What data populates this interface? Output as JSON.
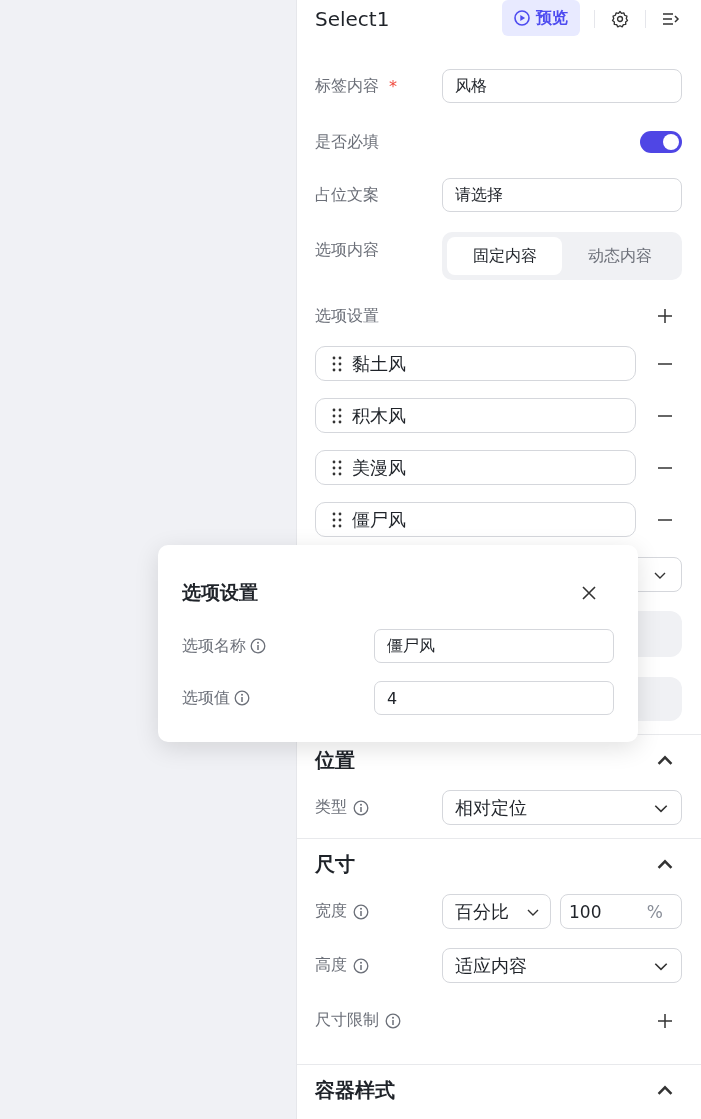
{
  "header": {
    "title": "Select1",
    "preview": "预览"
  },
  "fields": [
    {
      "kind": "input",
      "label": "标签内容",
      "required_mark": "*",
      "value": "风格"
    },
    {
      "kind": "switch",
      "label": "是否必填",
      "on": true
    },
    {
      "kind": "input",
      "label": "占位文案",
      "value": "请选择"
    },
    {
      "kind": "segmented",
      "label": "选项内容",
      "options": [
        {
          "label": "固定内容",
          "selected": true
        },
        {
          "label": "动态内容",
          "selected": false
        }
      ]
    }
  ],
  "options_settings": {
    "label": "选项设置",
    "items": [
      "黏土风",
      "积木风",
      "美漫风",
      "僵尸风"
    ]
  },
  "sections": [
    {
      "title": "位置",
      "expanded": true,
      "rows": [
        {
          "kind": "select",
          "label": "类型",
          "value": "相对定位"
        }
      ]
    },
    {
      "title": "尺寸",
      "expanded": true,
      "rows": [
        {
          "kind": "unit",
          "label": "宽度",
          "mode": "百分比",
          "value": "100",
          "unit": "%"
        },
        {
          "kind": "select",
          "label": "高度",
          "value": "适应内容"
        },
        {
          "kind": "add",
          "label": "尺寸限制"
        }
      ]
    },
    {
      "title": "容器样式",
      "expanded": true
    }
  ],
  "dialog": {
    "title": "选项设置",
    "fields": [
      {
        "label": "选项名称",
        "value": "僵尸风"
      },
      {
        "label": "选项值",
        "value": "4"
      }
    ]
  }
}
